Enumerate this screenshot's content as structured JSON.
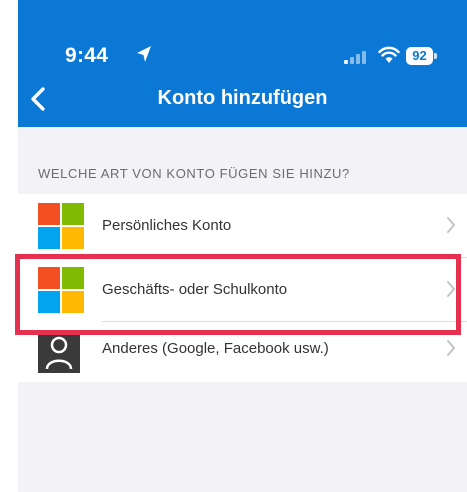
{
  "status_bar": {
    "time": "9:44",
    "battery": "92"
  },
  "nav": {
    "title": "Konto hinzufügen"
  },
  "section": {
    "header": "WELCHE ART VON KONTO FÜGEN SIE HINZU?"
  },
  "accounts": [
    {
      "label": "Persönliches Konto",
      "icon": "microsoft-logo-icon"
    },
    {
      "label": "Geschäfts- oder Schulkonto",
      "icon": "microsoft-logo-icon"
    },
    {
      "label": "Anderes (Google, Facebook usw.)",
      "icon": "person-icon"
    }
  ],
  "colors": {
    "header": "#0a78d4",
    "highlight": "#e5304f",
    "background": "#f2f2f7"
  }
}
